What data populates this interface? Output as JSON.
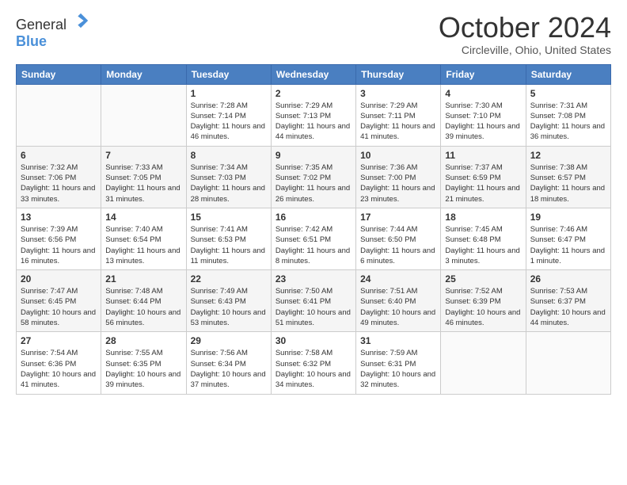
{
  "header": {
    "logo_general": "General",
    "logo_blue": "Blue",
    "month_title": "October 2024",
    "location": "Circleville, Ohio, United States"
  },
  "days_of_week": [
    "Sunday",
    "Monday",
    "Tuesday",
    "Wednesday",
    "Thursday",
    "Friday",
    "Saturday"
  ],
  "weeks": [
    [
      {
        "day": "",
        "info": ""
      },
      {
        "day": "",
        "info": ""
      },
      {
        "day": "1",
        "info": "Sunrise: 7:28 AM\nSunset: 7:14 PM\nDaylight: 11 hours and 46 minutes."
      },
      {
        "day": "2",
        "info": "Sunrise: 7:29 AM\nSunset: 7:13 PM\nDaylight: 11 hours and 44 minutes."
      },
      {
        "day": "3",
        "info": "Sunrise: 7:29 AM\nSunset: 7:11 PM\nDaylight: 11 hours and 41 minutes."
      },
      {
        "day": "4",
        "info": "Sunrise: 7:30 AM\nSunset: 7:10 PM\nDaylight: 11 hours and 39 minutes."
      },
      {
        "day": "5",
        "info": "Sunrise: 7:31 AM\nSunset: 7:08 PM\nDaylight: 11 hours and 36 minutes."
      }
    ],
    [
      {
        "day": "6",
        "info": "Sunrise: 7:32 AM\nSunset: 7:06 PM\nDaylight: 11 hours and 33 minutes."
      },
      {
        "day": "7",
        "info": "Sunrise: 7:33 AM\nSunset: 7:05 PM\nDaylight: 11 hours and 31 minutes."
      },
      {
        "day": "8",
        "info": "Sunrise: 7:34 AM\nSunset: 7:03 PM\nDaylight: 11 hours and 28 minutes."
      },
      {
        "day": "9",
        "info": "Sunrise: 7:35 AM\nSunset: 7:02 PM\nDaylight: 11 hours and 26 minutes."
      },
      {
        "day": "10",
        "info": "Sunrise: 7:36 AM\nSunset: 7:00 PM\nDaylight: 11 hours and 23 minutes."
      },
      {
        "day": "11",
        "info": "Sunrise: 7:37 AM\nSunset: 6:59 PM\nDaylight: 11 hours and 21 minutes."
      },
      {
        "day": "12",
        "info": "Sunrise: 7:38 AM\nSunset: 6:57 PM\nDaylight: 11 hours and 18 minutes."
      }
    ],
    [
      {
        "day": "13",
        "info": "Sunrise: 7:39 AM\nSunset: 6:56 PM\nDaylight: 11 hours and 16 minutes."
      },
      {
        "day": "14",
        "info": "Sunrise: 7:40 AM\nSunset: 6:54 PM\nDaylight: 11 hours and 13 minutes."
      },
      {
        "day": "15",
        "info": "Sunrise: 7:41 AM\nSunset: 6:53 PM\nDaylight: 11 hours and 11 minutes."
      },
      {
        "day": "16",
        "info": "Sunrise: 7:42 AM\nSunset: 6:51 PM\nDaylight: 11 hours and 8 minutes."
      },
      {
        "day": "17",
        "info": "Sunrise: 7:44 AM\nSunset: 6:50 PM\nDaylight: 11 hours and 6 minutes."
      },
      {
        "day": "18",
        "info": "Sunrise: 7:45 AM\nSunset: 6:48 PM\nDaylight: 11 hours and 3 minutes."
      },
      {
        "day": "19",
        "info": "Sunrise: 7:46 AM\nSunset: 6:47 PM\nDaylight: 11 hours and 1 minute."
      }
    ],
    [
      {
        "day": "20",
        "info": "Sunrise: 7:47 AM\nSunset: 6:45 PM\nDaylight: 10 hours and 58 minutes."
      },
      {
        "day": "21",
        "info": "Sunrise: 7:48 AM\nSunset: 6:44 PM\nDaylight: 10 hours and 56 minutes."
      },
      {
        "day": "22",
        "info": "Sunrise: 7:49 AM\nSunset: 6:43 PM\nDaylight: 10 hours and 53 minutes."
      },
      {
        "day": "23",
        "info": "Sunrise: 7:50 AM\nSunset: 6:41 PM\nDaylight: 10 hours and 51 minutes."
      },
      {
        "day": "24",
        "info": "Sunrise: 7:51 AM\nSunset: 6:40 PM\nDaylight: 10 hours and 49 minutes."
      },
      {
        "day": "25",
        "info": "Sunrise: 7:52 AM\nSunset: 6:39 PM\nDaylight: 10 hours and 46 minutes."
      },
      {
        "day": "26",
        "info": "Sunrise: 7:53 AM\nSunset: 6:37 PM\nDaylight: 10 hours and 44 minutes."
      }
    ],
    [
      {
        "day": "27",
        "info": "Sunrise: 7:54 AM\nSunset: 6:36 PM\nDaylight: 10 hours and 41 minutes."
      },
      {
        "day": "28",
        "info": "Sunrise: 7:55 AM\nSunset: 6:35 PM\nDaylight: 10 hours and 39 minutes."
      },
      {
        "day": "29",
        "info": "Sunrise: 7:56 AM\nSunset: 6:34 PM\nDaylight: 10 hours and 37 minutes."
      },
      {
        "day": "30",
        "info": "Sunrise: 7:58 AM\nSunset: 6:32 PM\nDaylight: 10 hours and 34 minutes."
      },
      {
        "day": "31",
        "info": "Sunrise: 7:59 AM\nSunset: 6:31 PM\nDaylight: 10 hours and 32 minutes."
      },
      {
        "day": "",
        "info": ""
      },
      {
        "day": "",
        "info": ""
      }
    ]
  ]
}
